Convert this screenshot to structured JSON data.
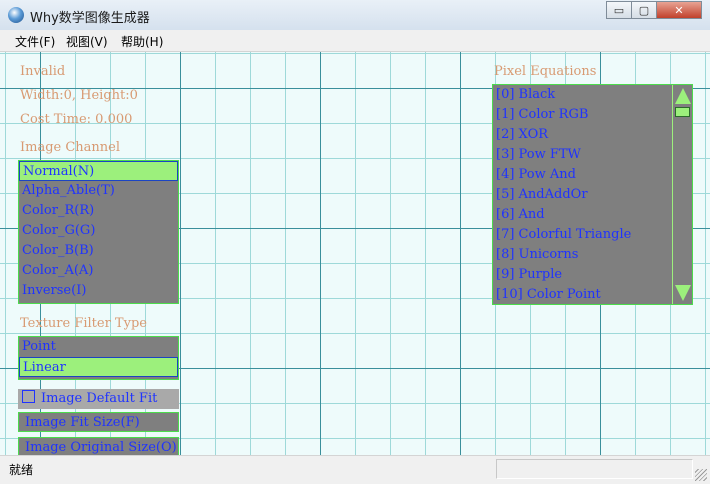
{
  "window": {
    "title": "Why数学图像生成器"
  },
  "titlebar_buttons": {
    "minimize": "▭",
    "maximize": "▢",
    "close": "✕"
  },
  "menu": [
    "文件(F)",
    "视图(V)",
    "帮助(H)"
  ],
  "info": {
    "status": "Invalid",
    "size": "Width:0, Height:0",
    "cost": "Cost Time: 0.000"
  },
  "image_channel": {
    "label": "Image Channel",
    "items": [
      "Normal(N)",
      "Alpha_Able(T)",
      "Color_R(R)",
      "Color_G(G)",
      "Color_B(B)",
      "Color_A(A)",
      "Inverse(I)"
    ],
    "selected": 0
  },
  "texture_filter": {
    "label": "Texture Filter Type",
    "items": [
      "Point",
      "Linear"
    ],
    "selected": 1
  },
  "default_fit": {
    "label": "Image Default Fit",
    "checked": false
  },
  "buttons": {
    "fit_size": "Image Fit Size(F)",
    "original_size": "Image Original Size(O)"
  },
  "pixel_equations": {
    "label": "Pixel Equations",
    "items": [
      "[0] Black",
      "[1] Color RGB",
      "[2] XOR",
      "[3] Pow FTW",
      "[4] Pow And",
      "[5] AndAddOr",
      "[6] And",
      "[7] Colorful Triangle",
      "[8] Unicorns",
      "[9] Purple",
      "[10] Color Point"
    ]
  },
  "statusbar": {
    "text": "就绪"
  },
  "colors": {
    "label": "#d89a72",
    "list_text": "#1f33ff",
    "list_bg": "#7f7f7f",
    "selected_bg": "#9cf07c",
    "border": "#4cdc4c",
    "grid_major": "#3a8f9b",
    "grid_minor": "#9ed9d9",
    "canvas_bg": "#eefbfb"
  }
}
